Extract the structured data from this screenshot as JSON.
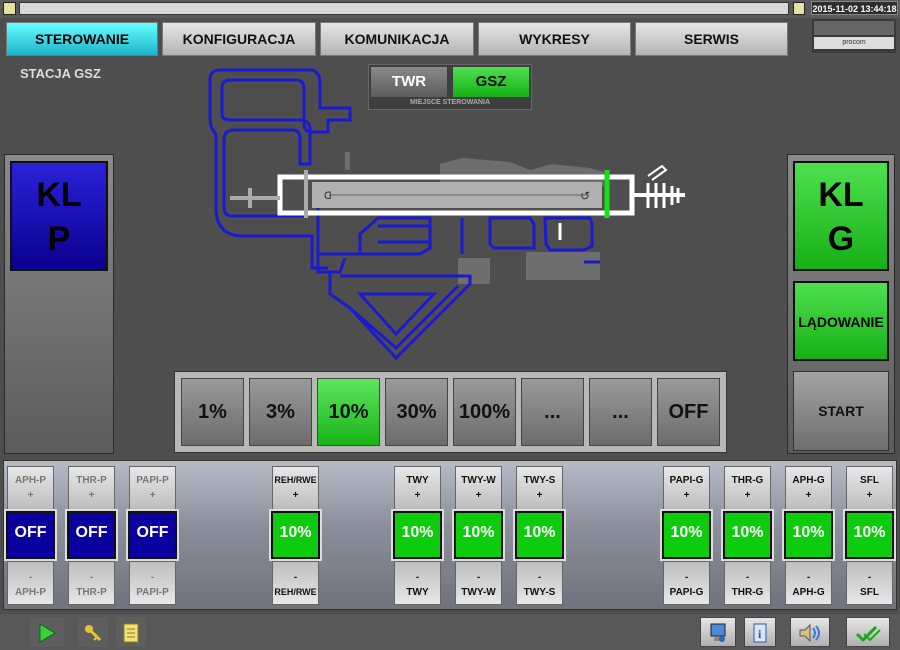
{
  "header": {
    "clock": "2015-11-02 13:44:18",
    "logo": "procom"
  },
  "tabs": [
    {
      "label": "STEROWANIE",
      "active": true
    },
    {
      "label": "KONFIGURACJA"
    },
    {
      "label": "KOMUNIKACJA"
    },
    {
      "label": "WYKRESY"
    },
    {
      "label": "SERWIS"
    }
  ],
  "station": "STACJA GSZ",
  "control_place": {
    "options": [
      "TWR",
      "GSZ"
    ],
    "selected": "GSZ",
    "caption": "MIEJSCE STEROWANIA"
  },
  "left_kl": {
    "line1": "KL",
    "line2": "P"
  },
  "right_kl": {
    "line1": "KL",
    "line2": "G"
  },
  "mode_button": "LĄDOWANIE",
  "start_button": "START",
  "intensity": {
    "options": [
      "1%",
      "3%",
      "10%",
      "30%",
      "100%",
      "...",
      "...",
      "OFF"
    ],
    "selected": "10%"
  },
  "circuits": [
    {
      "top": "APH-P",
      "plus": "+",
      "value": "OFF",
      "minus": "-",
      "bottom": "APH-P",
      "state": "off"
    },
    {
      "top": "THR-P",
      "plus": "+",
      "value": "OFF",
      "minus": "-",
      "bottom": "THR-P",
      "state": "off"
    },
    {
      "top": "PAPI-P",
      "plus": "+",
      "value": "OFF",
      "minus": "-",
      "bottom": "PAPI-P",
      "state": "off"
    },
    {
      "top": "REH/RWE",
      "plus": "+",
      "value": "10%",
      "minus": "-",
      "bottom": "REH/RWE",
      "state": "on"
    },
    {
      "top": "TWY",
      "plus": "+",
      "value": "10%",
      "minus": "-",
      "bottom": "TWY",
      "state": "on"
    },
    {
      "top": "TWY-W",
      "plus": "+",
      "value": "10%",
      "minus": "-",
      "bottom": "TWY-W",
      "state": "on"
    },
    {
      "top": "TWY-S",
      "plus": "+",
      "value": "10%",
      "minus": "-",
      "bottom": "TWY-S",
      "state": "on"
    },
    {
      "top": "PAPI-G",
      "plus": "+",
      "value": "10%",
      "minus": "-",
      "bottom": "PAPI-G",
      "state": "on"
    },
    {
      "top": "THR-G",
      "plus": "+",
      "value": "10%",
      "minus": "-",
      "bottom": "THR-G",
      "state": "on"
    },
    {
      "top": "APH-G",
      "plus": "+",
      "value": "10%",
      "minus": "-",
      "bottom": "APH-G",
      "state": "on"
    },
    {
      "top": "SFL",
      "plus": "+",
      "value": "10%",
      "minus": "-",
      "bottom": "SFL",
      "state": "on"
    }
  ],
  "statusbar": {
    "icons": [
      "play-icon",
      "key-icon",
      "notes-icon",
      "monitor-icon",
      "info-icon",
      "sound-icon",
      "check-icon"
    ]
  },
  "colors": {
    "active_tab": "#1bd3e3",
    "green": "#16c016",
    "blue": "#0a00a0",
    "taxiway": "#1a1ad0"
  }
}
